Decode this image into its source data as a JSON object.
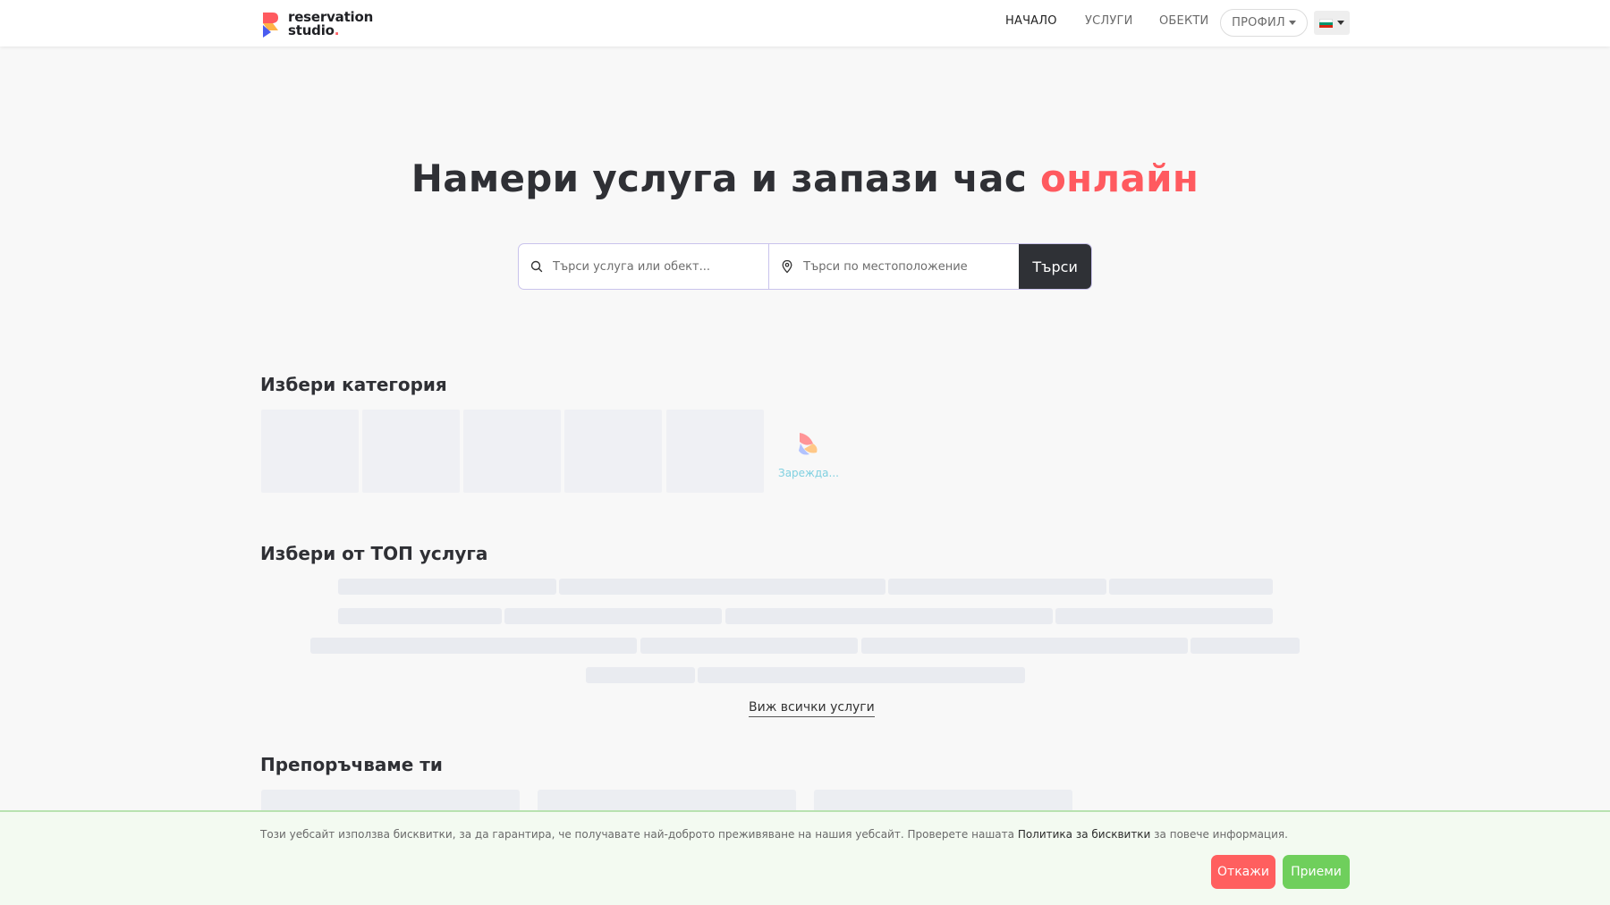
{
  "header": {
    "logo_line1": "reservation",
    "logo_line2": "studio",
    "logo_dot": ".",
    "nav": [
      {
        "label": "НАЧАЛО",
        "active": true
      },
      {
        "label": "УСЛУГИ",
        "active": false
      },
      {
        "label": "ОБЕКТИ",
        "active": false
      }
    ],
    "profile_label": "ПРОФИЛ",
    "language_icon": "bulgarian-flag-icon",
    "flag_colors": [
      "#ffffff",
      "#00966e",
      "#d62612"
    ]
  },
  "hero": {
    "title_main": "Намери услуга и запази час ",
    "title_accent": "онлайн",
    "search_placeholder": "Търси услуга или обект...",
    "location_placeholder": "Търси по местоположение",
    "search_button": "Търси"
  },
  "categories": {
    "title": "Избери категория",
    "loading_text": "Зарежда..."
  },
  "top_services": {
    "title": "Избери от ТОП услуга",
    "view_all": "Виж всички услуги"
  },
  "recommended": {
    "title": "Препоръчваме ти"
  },
  "cookie": {
    "text_before": "Този уебсайт използва бисквитки, за да гарантира, че получавате най-доброто преживяване на нашия уебсайт. Проверете нашата ",
    "link": "Политика за бисквитки",
    "text_after": " за повече информация.",
    "decline": "Откажи",
    "accept": "Приеми"
  },
  "colors": {
    "accent": "#ff5a5f",
    "dark": "#2f3136",
    "accept": "#6fcf5c",
    "decline": "#ff5f5f"
  }
}
